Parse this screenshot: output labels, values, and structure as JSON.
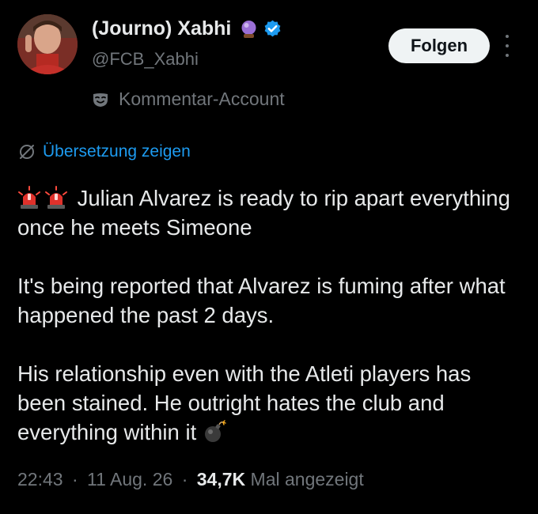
{
  "author": {
    "display_name": "(Journo) Xabhi",
    "handle": "@FCB_Xabhi",
    "label": "Kommentar-Account",
    "badges": [
      "crystal-ball-icon",
      "verified-icon"
    ]
  },
  "actions": {
    "follow_label": "Folgen",
    "more_icon": "more-vertical-icon"
  },
  "translate": {
    "label": "Übersetzung zeigen"
  },
  "tweet": {
    "paragraphs": [
      {
        "lead_emojis": [
          "police-light-emoji",
          "police-light-emoji"
        ],
        "text": "Julian Alvarez is ready to rip apart everything once he meets Simeone"
      },
      {
        "text": "It's being reported that Alvarez is fuming after what happened the past 2 days."
      },
      {
        "text": "His relationship even with the Atleti players has been stained. He outright hates the club and everything within it",
        "trail_emoji": "bomb-emoji"
      }
    ]
  },
  "meta": {
    "time": "22:43",
    "date": "11 Aug. 26",
    "views_count": "34,7K",
    "views_label": "Mal angezeigt",
    "separator": "·"
  },
  "colors": {
    "background": "#000000",
    "text": "#e7e9ea",
    "secondary": "#71767b",
    "link": "#1d9bf0",
    "verified": "#1d9bf0",
    "button_bg": "#eff3f4"
  }
}
